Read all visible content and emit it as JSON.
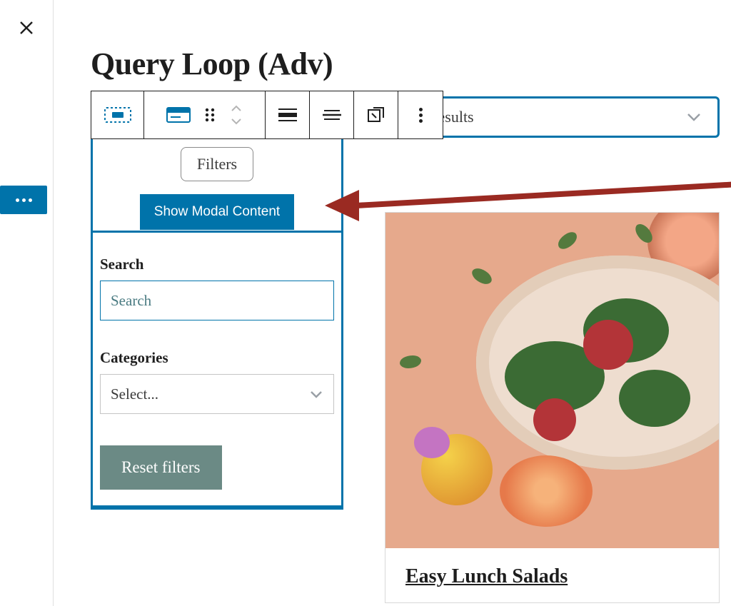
{
  "page": {
    "title": "Query Loop (Adv)"
  },
  "sort": {
    "label": "Sort results"
  },
  "filters": {
    "chip_label": "Filters",
    "show_modal_label": "Show Modal Content",
    "search": {
      "label": "Search",
      "placeholder": "Search"
    },
    "categories": {
      "label": "Categories",
      "selected": "Select..."
    },
    "reset_label": "Reset filters"
  },
  "results": {
    "cards": [
      {
        "title": "Easy Lunch Salads"
      }
    ]
  },
  "icons": {
    "close": "close-icon",
    "more": "more-icon",
    "parent": "parent-block-icon",
    "block_col": "columns-block-icon",
    "drag": "drag-handle-icon",
    "updown": "move-updown-icon",
    "align_full": "align-full-icon",
    "align_center": "align-content-center-icon",
    "overlap": "stretch-icon",
    "chev": "chevron-down-icon"
  }
}
